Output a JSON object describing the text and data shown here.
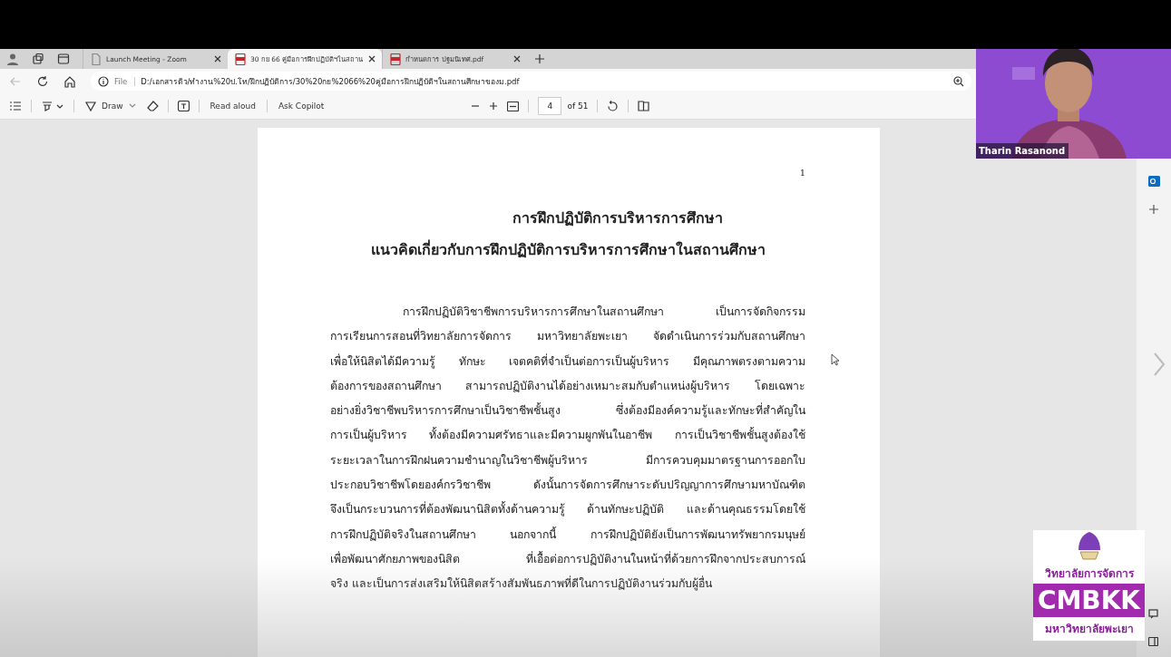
{
  "browser": {
    "tabs": [
      {
        "title": "Launch Meeting - Zoom",
        "kind": "page",
        "selected": false
      },
      {
        "title": "30 กย 66 คู่มือการฝึกปฏิบัติฯในสถาน",
        "kind": "pdf",
        "selected": true
      },
      {
        "title": "กำหนดการ ปฐมนิเทศ.pdf",
        "kind": "pdf",
        "selected": false
      }
    ],
    "address": {
      "scheme": "File",
      "url": "D:/เอกสารดิว/ทำงาน%20ป.โท/ฝึกปฏิบัติการ/30%20กย%2066%20คู่มือการฝึกปฏิบัติฯในสถานศึกษาของม.pdf"
    },
    "pdf_toolbar": {
      "draw": "Draw",
      "read_aloud": "Read aloud",
      "ask_copilot": "Ask Copilot",
      "page": "4",
      "page_count": "of 51"
    }
  },
  "document": {
    "page_number": "1",
    "title_lines": [
      "การฝึกปฏิบัติการบริหารการศึกษา",
      "แนวคิดเกี่ยวกับการฝึกปฏิบัติการบริหารการศึกษาในสถานศึกษา"
    ],
    "paragraph_lines": [
      "การฝึกปฏิบัติวิชาชีพการบริหารการศึกษาในสถานศึกษา เป็นการจัดกิจกรรม",
      "การเรียนการสอนที่วิทยาลัยการจัดการ มหาวิทยาลัยพะเยา จัดดำเนินการร่วมกับสถานศึกษา",
      "เพื่อให้นิสิตได้มีความรู้ ทักษะ เจตคติที่จำเป็นต่อการเป็นผู้บริหาร มีคุณภาพตรงตามความ",
      "ต้องการของสถานศึกษา สามารถปฏิบัติงานได้อย่างเหมาะสมกับตำแหน่งผู้บริหาร โดยเฉพาะ",
      "อย่างยิ่งวิชาชีพบริหารการศึกษาเป็นวิชาชีพชั้นสูง ซึ่งต้องมีองค์ความรู้และทักษะที่สำคัญใน",
      "การเป็นผู้บริหาร ทั้งต้องมีความศรัทธาและมีความผูกพันในอาชีพ การเป็นวิชาชีพชั้นสูงต้องใช้",
      "ระยะเวลาในการฝึกฝนความชำนาญในวิชาชีพผู้บริหาร  มีการควบคุมมาตรฐานการออกใบ",
      "ประกอบวิชาชีพโดยองค์กรวิชาชีพ ดังนั้นการจัดการศึกษาระดับปริญญาการศึกษามหาบัณฑิต",
      "จึงเป็นกระบวนการที่ต้องพัฒนานิสิตทั้งด้านความรู้ ด้านทักษะปฏิบัติ และด้านคุณธรรมโดยใช้",
      "การฝึกปฏิบัติจริงในสถานศึกษา นอกจากนี้ การฝึกปฏิบัติยังเป็นการพัฒนาทรัพยากรมนุษย์",
      "เพื่อพัฒนาศักยภาพของนิสิต ที่เอื้อต่อการปฏิบัติงานในหน้าที่ด้วยการฝึกจากประสบการณ์",
      "จริง และเป็นการส่งเสริมให้นิสิตสร้างสัมพันธภาพที่ดีในการปฏิบัติงานร่วมกับผู้อื่น"
    ]
  },
  "video": {
    "name": "Tharin Rasanond",
    "kind": "picture"
  },
  "logo": {
    "top": "วิทยาลัยการจัดการ",
    "middle": "CMBKK",
    "bottom": "มหาวิทยาลัยพะเยา"
  }
}
